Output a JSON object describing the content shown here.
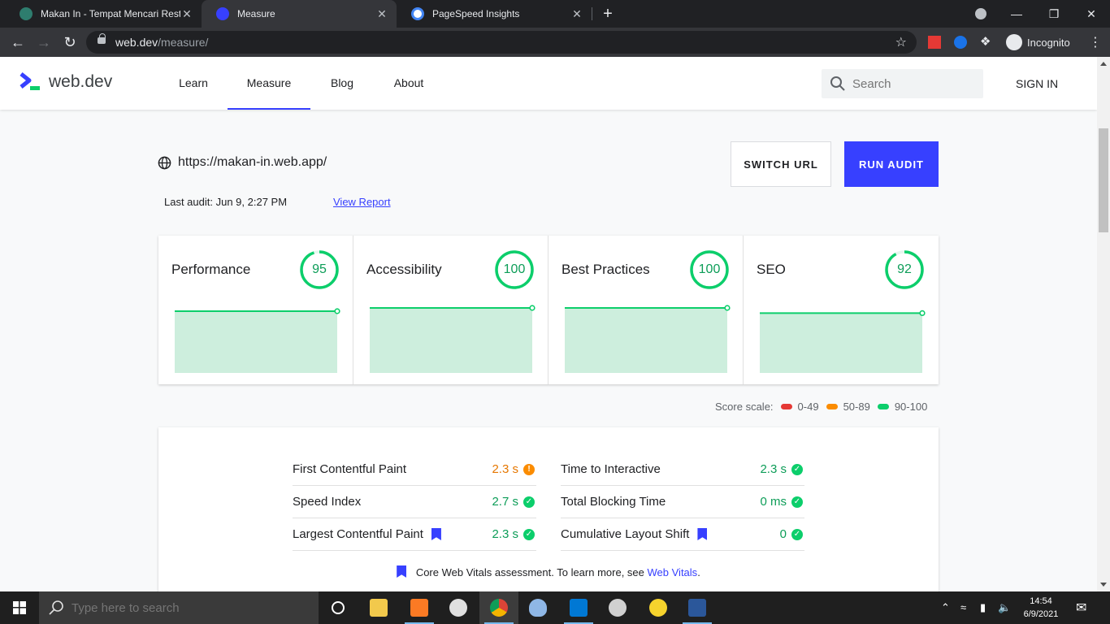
{
  "browser": {
    "tabs": [
      {
        "title": "Makan In - Tempat Mencari Resta"
      },
      {
        "title": "Measure"
      },
      {
        "title": "PageSpeed Insights"
      }
    ],
    "url_domain": "web.dev",
    "url_path": "/measure/",
    "incognito_label": "Incognito"
  },
  "site": {
    "logo_text": "web.dev",
    "nav": [
      "Learn",
      "Measure",
      "Blog",
      "About"
    ],
    "search_placeholder": "Search",
    "signin": "SIGN IN"
  },
  "audit": {
    "url": "https://makan-in.web.app/",
    "last_audit": "Last audit: Jun 9, 2:27 PM",
    "view_report": "View Report",
    "switch_url": "SWITCH URL",
    "run_audit": "RUN AUDIT"
  },
  "scores": [
    {
      "name": "Performance",
      "score": "95",
      "value": 95
    },
    {
      "name": "Accessibility",
      "score": "100",
      "value": 100
    },
    {
      "name": "Best Practices",
      "score": "100",
      "value": 100
    },
    {
      "name": "SEO",
      "score": "92",
      "value": 92
    }
  ],
  "score_scale": {
    "label": "Score scale:",
    "ranges": [
      {
        "range": "0-49",
        "color": "#e53935"
      },
      {
        "range": "50-89",
        "color": "#fb8c00"
      },
      {
        "range": "90-100",
        "color": "#0cce6b"
      }
    ]
  },
  "metrics": {
    "left": [
      {
        "name": "First Contentful Paint",
        "value": "2.3 s",
        "status": "average",
        "cwv": false
      },
      {
        "name": "Speed Index",
        "value": "2.7 s",
        "status": "good",
        "cwv": false
      },
      {
        "name": "Largest Contentful Paint",
        "value": "2.3 s",
        "status": "good",
        "cwv": true
      }
    ],
    "right": [
      {
        "name": "Time to Interactive",
        "value": "2.3 s",
        "status": "good",
        "cwv": false
      },
      {
        "name": "Total Blocking Time",
        "value": "0 ms",
        "status": "good",
        "cwv": false
      },
      {
        "name": "Cumulative Layout Shift",
        "value": "0",
        "status": "good",
        "cwv": true
      }
    ],
    "cwv_text": "Core Web Vitals assessment. To learn more, see",
    "cwv_link": "Web Vitals",
    "cwv_end": "."
  },
  "colors": {
    "accent": "#3740ff",
    "good": "#0cce6b",
    "good_text": "#0d9d58",
    "average": "#e67700",
    "chart_fill": "#cdeedd"
  },
  "taskbar": {
    "search_placeholder": "Type here to search",
    "time": "14:54",
    "date": "6/9/2021"
  }
}
